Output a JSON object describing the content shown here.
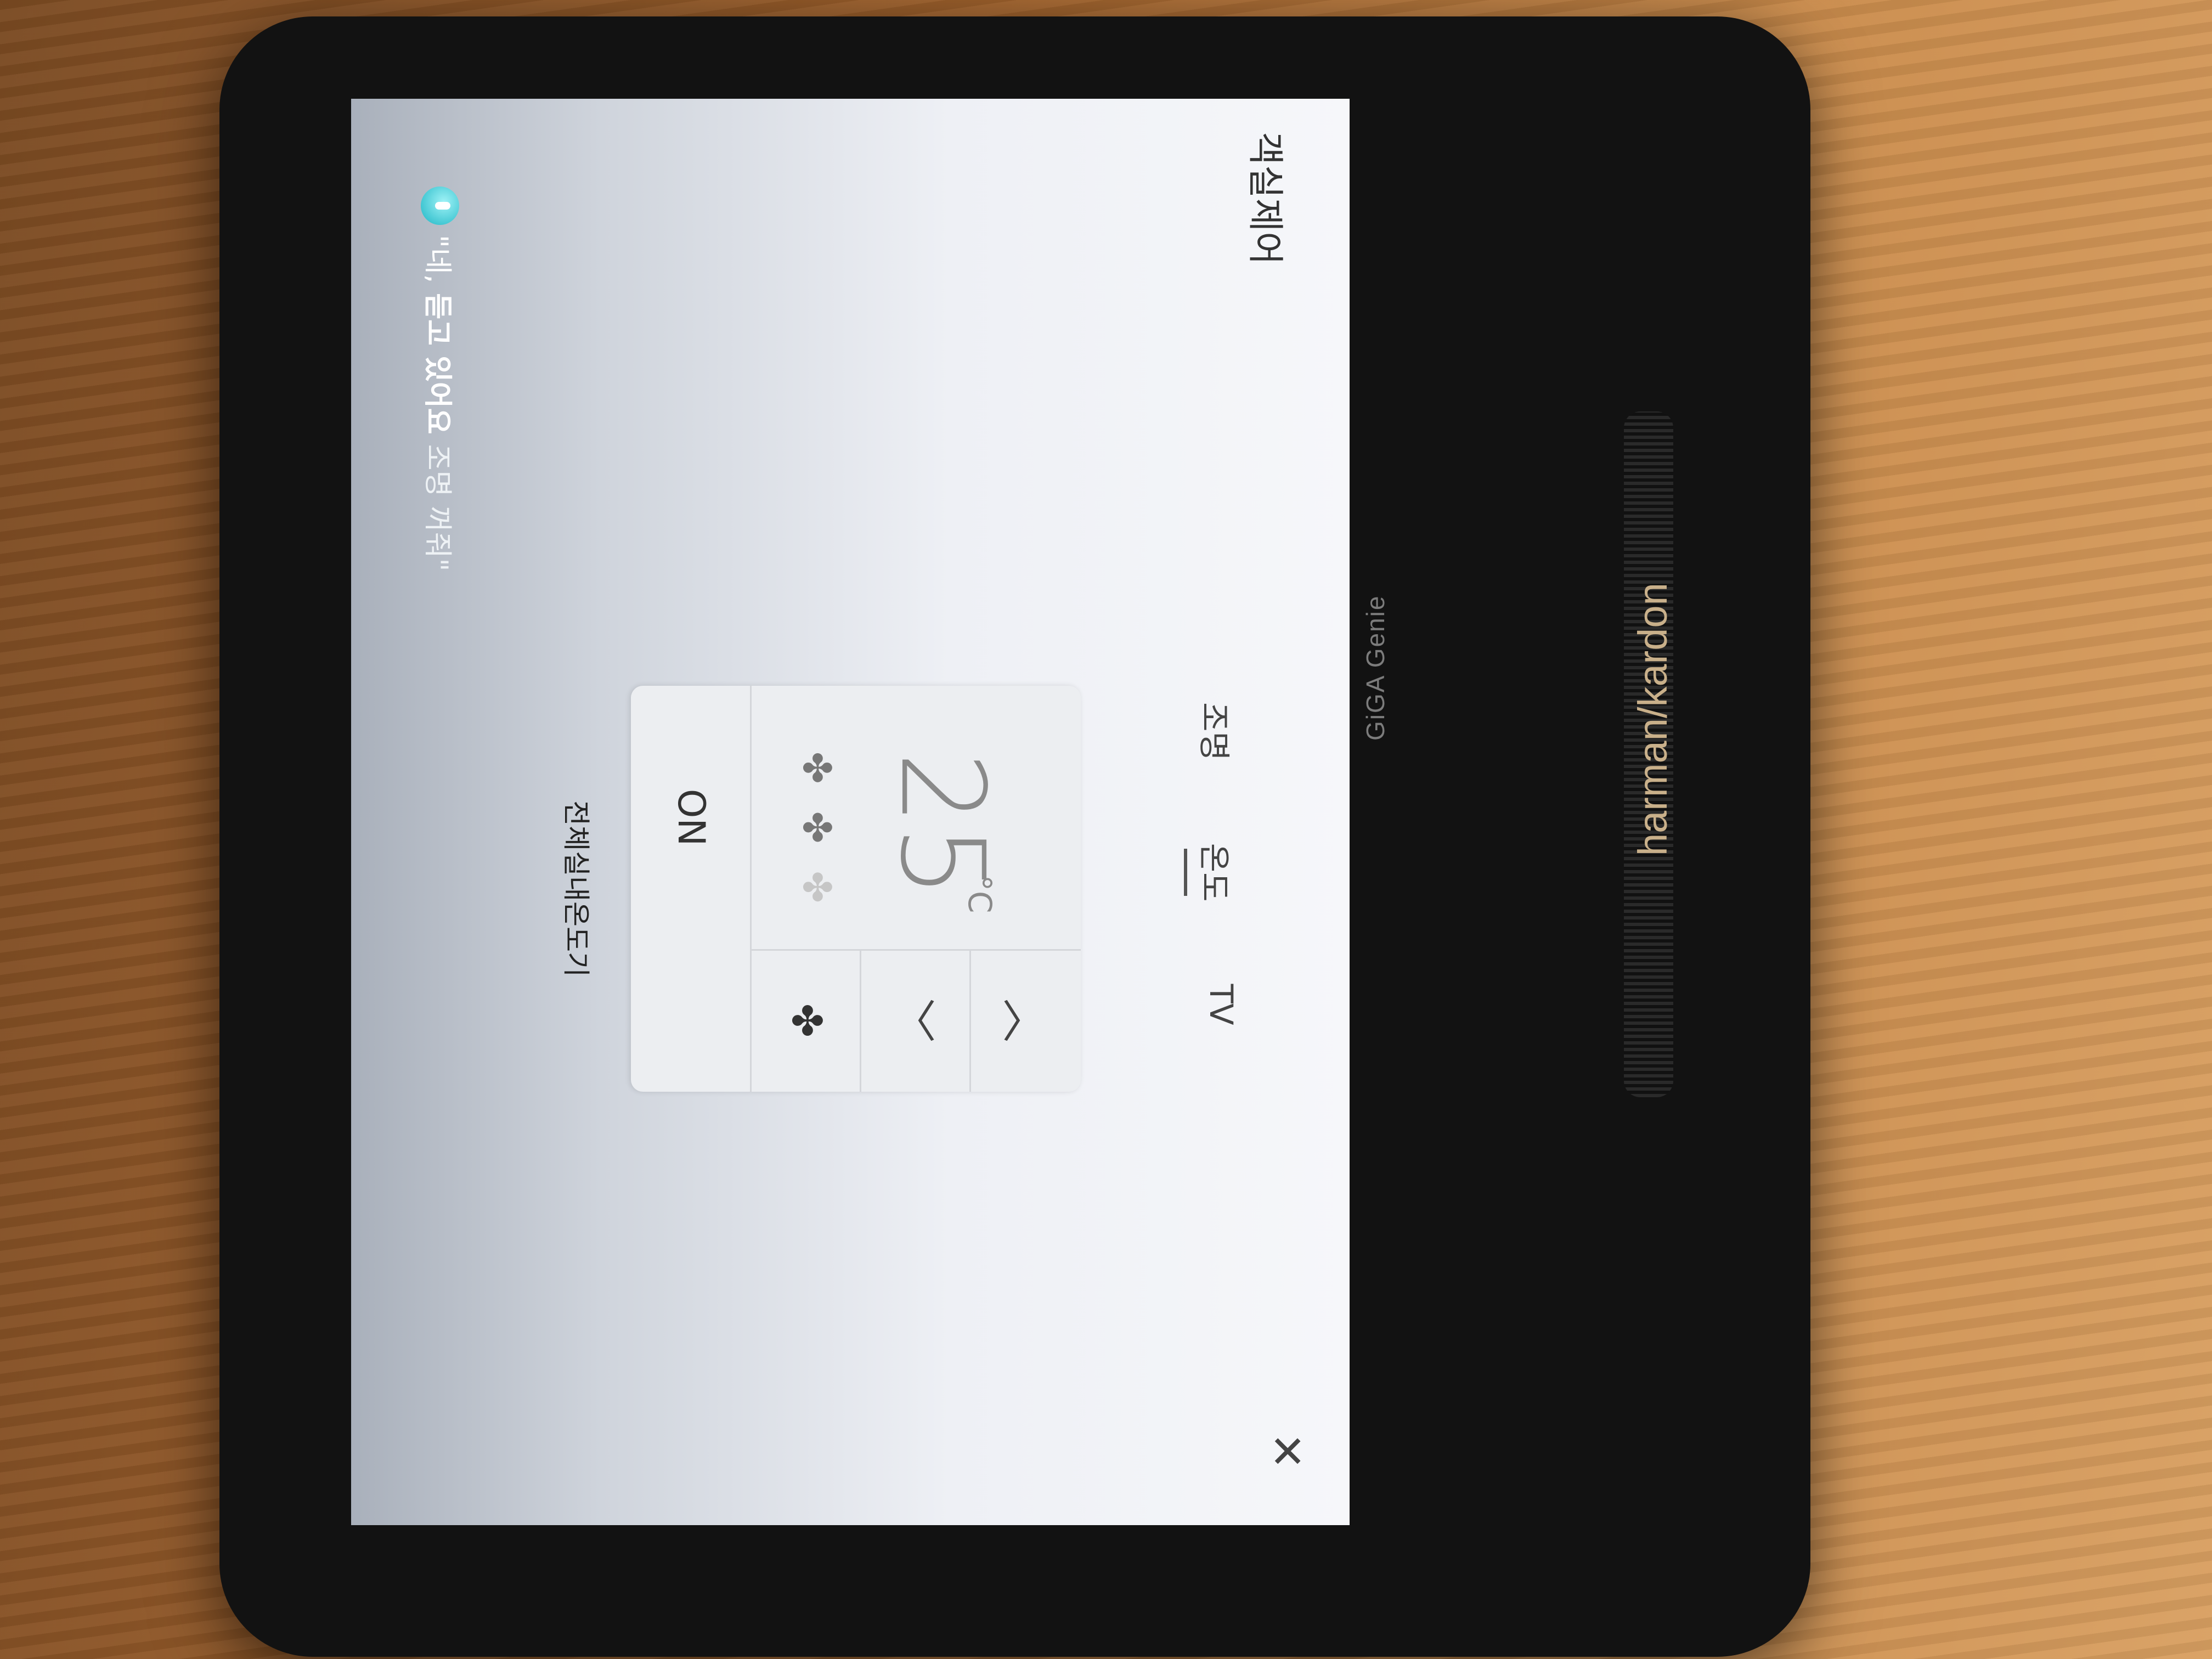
{
  "app": {
    "title": "객실제어"
  },
  "tabs": [
    {
      "label": "조명",
      "active": false
    },
    {
      "label": "온도",
      "active": true
    },
    {
      "label": "TV",
      "active": false
    }
  ],
  "thermostat": {
    "temperature": "25",
    "unit": "°C",
    "power": "ON",
    "caption": "전체실내온도기",
    "fan_speed_level": 2,
    "fan_speed_max": 3
  },
  "controls": {
    "up_icon": "chevron-up-icon",
    "down_icon": "chevron-down-icon",
    "fan_icon": "fan-icon"
  },
  "voice": {
    "prefix": "\"네,",
    "listening": "듣고 있어요",
    "example": "조명 꺼줘\""
  },
  "device": {
    "brand_left": "GiGA Genie",
    "brand_right": "harman/kardon"
  },
  "colors": {
    "voice_accent": "#1bb5c4"
  }
}
